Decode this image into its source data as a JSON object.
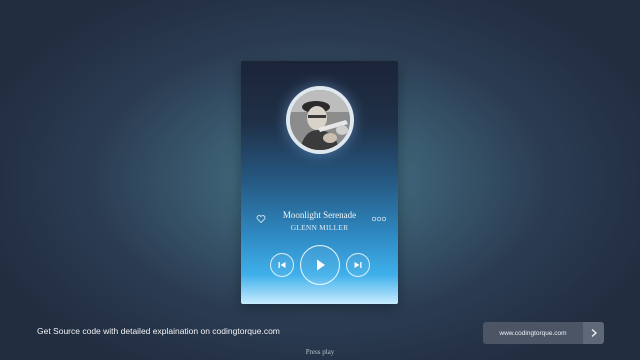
{
  "player": {
    "song_title": "Moonlight Serenade",
    "artist": "GLENN MILLER",
    "icons": {
      "like": "heart-icon",
      "more": "more-icon",
      "previous": "previous-icon",
      "play": "play-icon",
      "next": "next-icon",
      "album_art": "album-art"
    }
  },
  "footer": {
    "text": "Get Source code with detailed explaination on codingtorque.com",
    "site_button_label": "www.codingtorque.com",
    "arrow_icon": "chevron-right-icon"
  },
  "hint": "Press play",
  "colors": {
    "page_bg_center": "#4f7f91",
    "page_bg_edge": "#222d40",
    "player_top": "#1c2438",
    "player_bottom": "#c8ecff",
    "button_bg": "#4c5566"
  }
}
